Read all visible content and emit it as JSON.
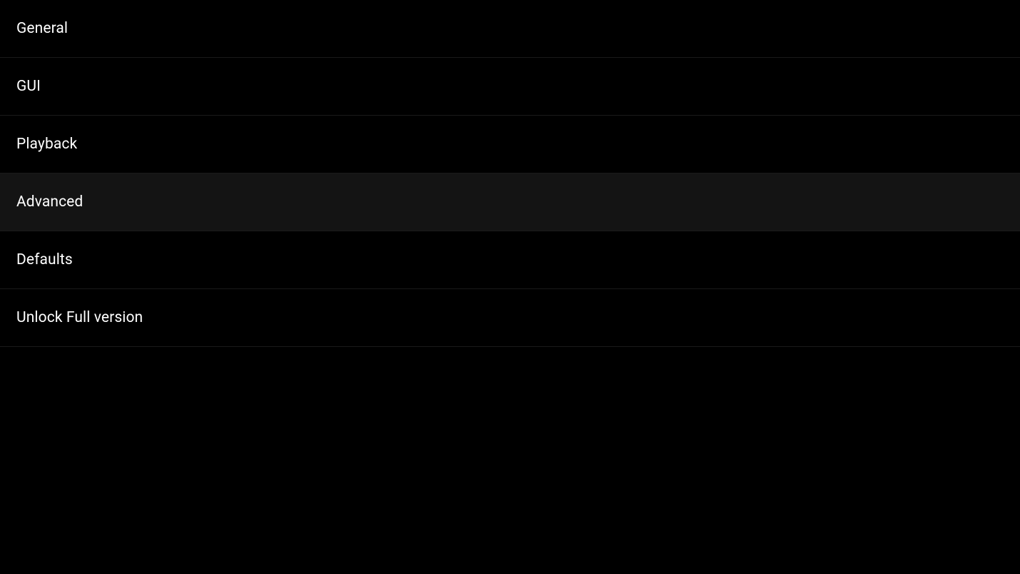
{
  "menu": {
    "items": [
      {
        "label": "General"
      },
      {
        "label": "GUI"
      },
      {
        "label": "Playback"
      },
      {
        "label": "Advanced"
      },
      {
        "label": "Defaults"
      },
      {
        "label": "Unlock Full version"
      }
    ],
    "selectedIndex": 3
  }
}
